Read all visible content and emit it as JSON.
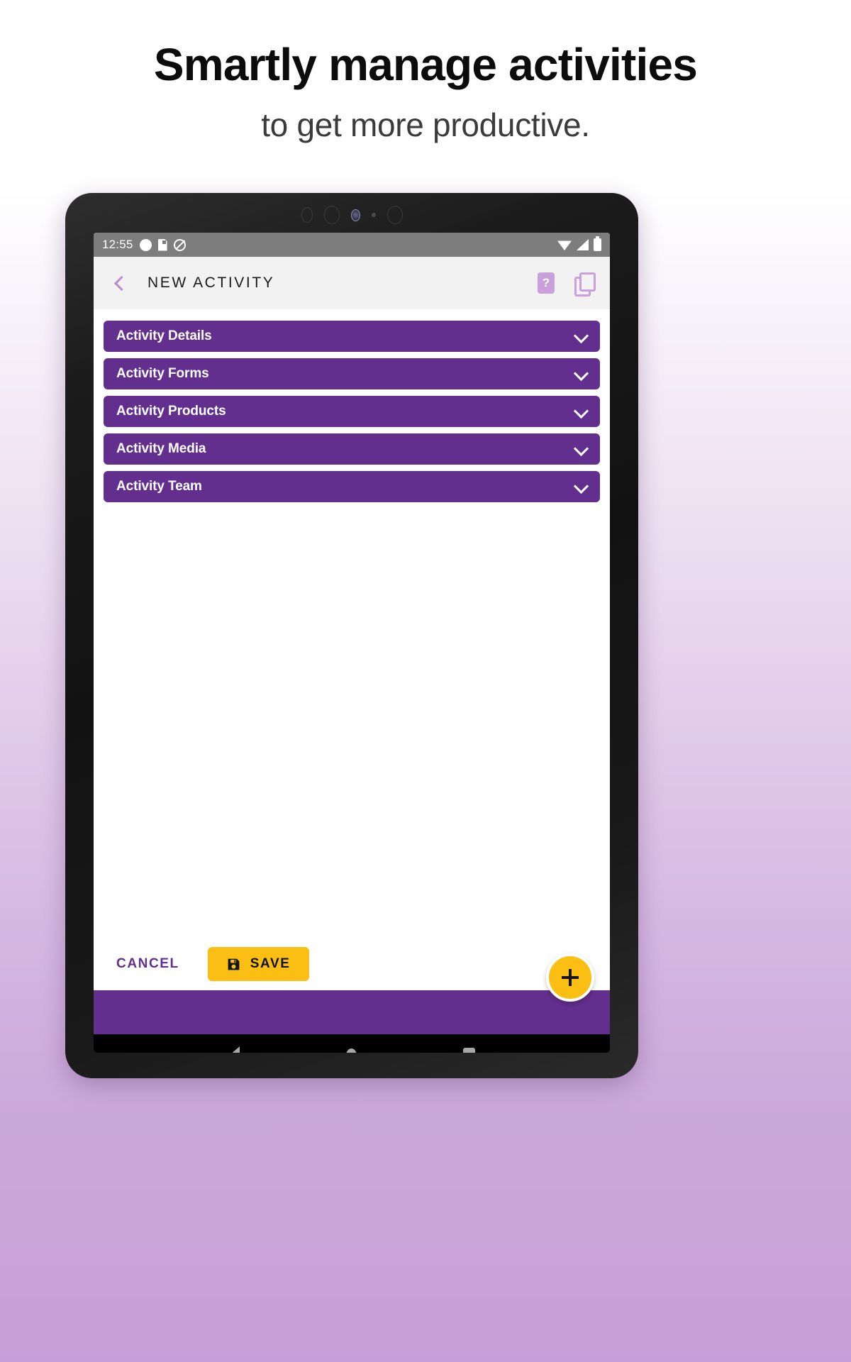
{
  "promo": {
    "headline": "Smartly manage activities",
    "subheadline": "to get more productive."
  },
  "colors": {
    "brand_purple": "#632F8F",
    "accent_yellow": "#FBBF14",
    "light_purple": "#C9A0DC",
    "background_bottom": "#C79FD8"
  },
  "device": {
    "statusbar": {
      "time": "12:55",
      "left_icons": [
        "circle-icon",
        "sd-card-icon",
        "no-signal-icon"
      ],
      "right_icons": [
        "wifi-icon",
        "cellular-signal-icon",
        "battery-icon"
      ]
    },
    "navbar": {
      "items": [
        "back-nav-icon",
        "home-nav-icon",
        "recents-nav-icon"
      ]
    }
  },
  "app": {
    "toolbar": {
      "back_icon": "back-chevron-icon",
      "title": "NEW ACTIVITY",
      "help_label": "?",
      "copy_icon": "copy-icon"
    },
    "accordion": [
      {
        "label": "Activity Details",
        "chevron": "chevron-down-icon"
      },
      {
        "label": "Activity Forms",
        "chevron": "chevron-down-icon"
      },
      {
        "label": "Activity Products",
        "chevron": "chevron-down-icon"
      },
      {
        "label": "Activity Media",
        "chevron": "chevron-down-icon"
      },
      {
        "label": "Activity Team",
        "chevron": "chevron-down-icon"
      }
    ],
    "actions": {
      "cancel_label": "CANCEL",
      "save_label": "SAVE",
      "save_icon": "save-floppy-icon",
      "fab_icon": "plus-icon"
    }
  }
}
